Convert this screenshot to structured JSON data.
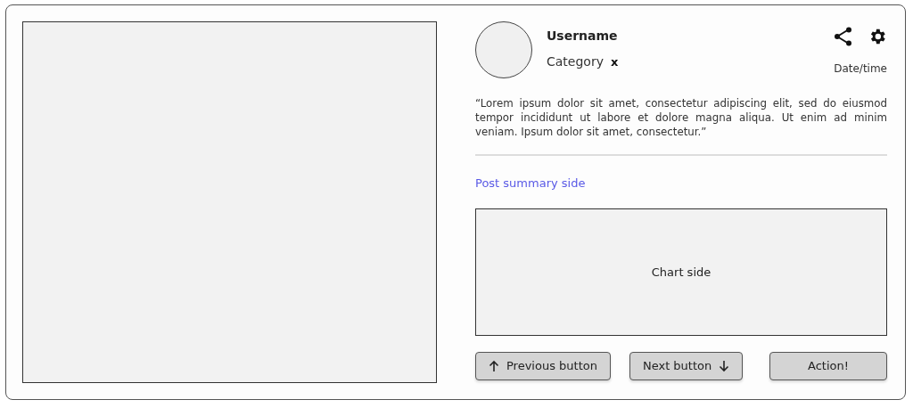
{
  "post": {
    "username": "Username",
    "category": "Category",
    "category_remove": "x",
    "datetime": "Date/time",
    "quote": "“Lorem ipsum dolor sit amet, consectetur adipiscing elit, sed do eiusmod tempor incididunt ut labore et dolore magna aliqua. Ut enim ad minim veniam. Ipsum dolor sit amet, consectetur.”",
    "summary_link": "Post summary side",
    "chart_placeholder": "Chart side"
  },
  "buttons": [
    {
      "label": "Previous button",
      "kind": "previous"
    },
    {
      "label": "Next button",
      "kind": "next"
    },
    {
      "label": "Action!",
      "kind": "action"
    }
  ]
}
